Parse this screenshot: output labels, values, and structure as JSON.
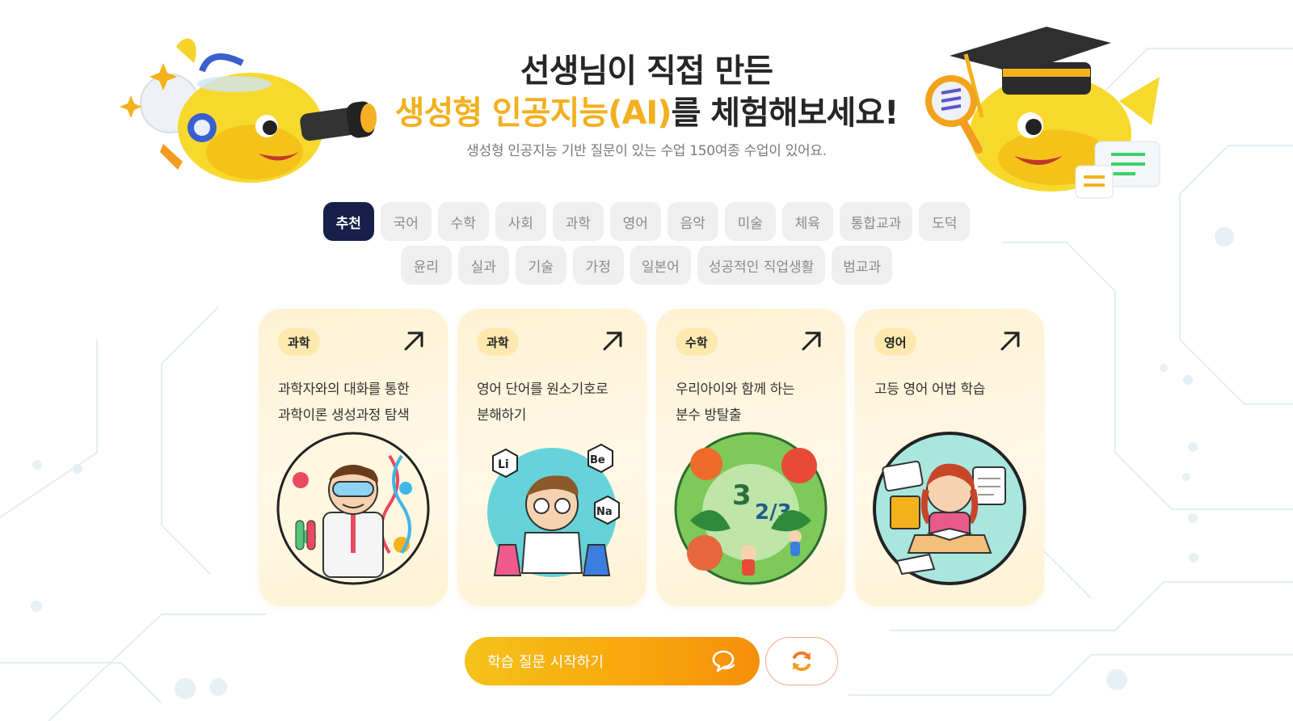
{
  "hero": {
    "line1": "선생님이 직접 만든",
    "line2_highlight": "생성형 인공지능(AI)",
    "line2_rest": "를 체험해보세요!",
    "subtitle": "생성형 인공지능 기반 질문이 있는 수업 150여종 수업이 있어요."
  },
  "categories": {
    "row1": [
      "추천",
      "국어",
      "수학",
      "사회",
      "과학",
      "영어",
      "음악",
      "미술",
      "체육",
      "통합교과",
      "도덕"
    ],
    "row2": [
      "윤리",
      "실과",
      "기술",
      "가정",
      "일본어",
      "성공적인 직업생활",
      "범교과"
    ],
    "selected": "추천"
  },
  "cards": [
    {
      "tag": "과학",
      "title": "과학자와의 대화를 통한\n과학이론 생성과정 탐색",
      "image": "scientist-illustration"
    },
    {
      "tag": "과학",
      "title": "영어 단어를 원소기호로\n분해하기",
      "image": "chemistry-illustration"
    },
    {
      "tag": "수학",
      "title": "우리아이와 함께 하는\n분수 방탈출",
      "image": "fraction-jungle-illustration"
    },
    {
      "tag": "영어",
      "title": "고등 영어 어법 학습",
      "image": "english-study-illustration"
    }
  ],
  "actions": {
    "start_label": "학습 질문 시작하기",
    "start_icon": "chat-bubble-icon",
    "refresh_icon": "refresh-icon"
  },
  "colors": {
    "accent": "#f2b01e",
    "selected_chip": "#16204a",
    "cta_start": "#f5c21a",
    "cta_end": "#f58f0a",
    "card_bg": "#fdf4dc",
    "refresh": "#f07a2b"
  }
}
